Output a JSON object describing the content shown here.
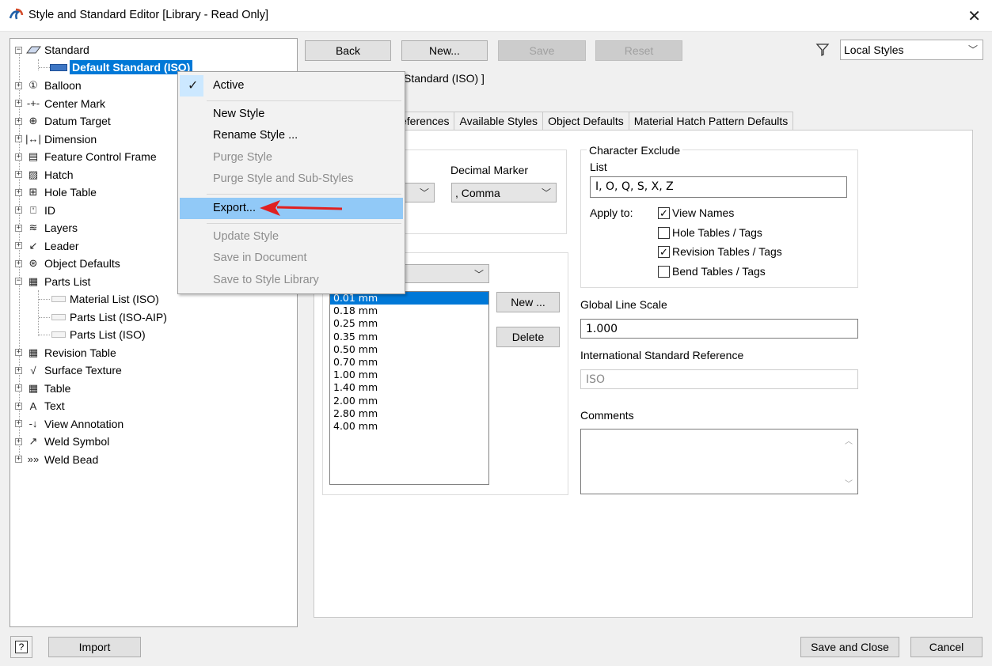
{
  "window": {
    "title": "Style and Standard Editor [Library - Read Only]"
  },
  "tree": {
    "root": "Standard",
    "selected": "Default Standard (ISO)",
    "items": [
      {
        "label": "Balloon",
        "icon": "balloon-icon",
        "glyph": "①"
      },
      {
        "label": "Center Mark",
        "icon": "center-mark-icon",
        "glyph": "-+-"
      },
      {
        "label": "Datum Target",
        "icon": "datum-target-icon",
        "glyph": "⊕"
      },
      {
        "label": "Dimension",
        "icon": "dimension-icon",
        "glyph": "|↔|"
      },
      {
        "label": "Feature Control Frame",
        "icon": "feature-control-frame-icon",
        "glyph": "▤"
      },
      {
        "label": "Hatch",
        "icon": "hatch-icon",
        "glyph": "▨"
      },
      {
        "label": "Hole Table",
        "icon": "hole-table-icon",
        "glyph": "⊞"
      },
      {
        "label": "ID",
        "icon": "id-icon",
        "glyph": "⍞"
      },
      {
        "label": "Layers",
        "icon": "layers-icon",
        "glyph": "≋"
      },
      {
        "label": "Leader",
        "icon": "leader-icon",
        "glyph": "↙"
      },
      {
        "label": "Object Defaults",
        "icon": "object-defaults-icon",
        "glyph": "⊛"
      },
      {
        "label": "Parts List",
        "icon": "parts-list-icon",
        "glyph": "▦"
      }
    ],
    "parts_children": [
      "Material List (ISO)",
      "Parts List (ISO-AIP)",
      "Parts List (ISO)"
    ],
    "items_after": [
      {
        "label": "Revision Table",
        "icon": "revision-table-icon",
        "glyph": "▦"
      },
      {
        "label": "Surface Texture",
        "icon": "surface-texture-icon",
        "glyph": "√"
      },
      {
        "label": "Table",
        "icon": "table-icon",
        "glyph": "▦"
      },
      {
        "label": "Text",
        "icon": "text-icon",
        "glyph": "A"
      },
      {
        "label": "View Annotation",
        "icon": "view-annotation-icon",
        "glyph": "-↓"
      },
      {
        "label": "Weld Symbol",
        "icon": "weld-symbol-icon",
        "glyph": "↗"
      },
      {
        "label": "Weld Bead",
        "icon": "weld-bead-icon",
        "glyph": "»»"
      }
    ]
  },
  "toolbar": {
    "back": "Back",
    "new": "New...",
    "save": "Save",
    "reset": "Reset",
    "filter": "Local Styles"
  },
  "header_partial": "Standard (ISO) ]",
  "tabs": [
    "eferences",
    "Available Styles",
    "Object Defaults",
    "Material Hatch Pattern Defaults"
  ],
  "units": {
    "decimal_marker_label": "Decimal Marker",
    "decimal_marker_value": ", Comma"
  },
  "line_weights": {
    "values": [
      "0.01 mm",
      "0.18 mm",
      "0.25 mm",
      "0.35 mm",
      "0.50 mm",
      "0.70 mm",
      "1.00 mm",
      "1.40 mm",
      "2.00 mm",
      "2.80 mm",
      "4.00 mm"
    ],
    "new": "New ...",
    "delete": "Delete"
  },
  "char_exclude": {
    "legend": "Character Exclude",
    "list_label": "List",
    "list_value": "I, O, Q, S, X, Z",
    "apply_label": "Apply to:",
    "options": [
      {
        "label": "View Names",
        "checked": "✓"
      },
      {
        "label": "Hole Tables / Tags",
        "checked": ""
      },
      {
        "label": "Revision Tables / Tags",
        "checked": "✓"
      },
      {
        "label": "Bend Tables / Tags",
        "checked": ""
      }
    ]
  },
  "global_line_scale": {
    "label": "Global Line Scale",
    "value": "1.000"
  },
  "intl_std_ref": {
    "label": "International Standard Reference",
    "value": "ISO"
  },
  "comments": {
    "label": "Comments"
  },
  "context_menu": {
    "active": "Active",
    "new_style": "New Style",
    "rename_style": "Rename Style ...",
    "purge_style": "Purge Style",
    "purge_sub": "Purge Style and Sub-Styles",
    "export": "Export...",
    "update_style": "Update Style",
    "save_in_document": "Save in Document",
    "save_to_library": "Save to Style Library"
  },
  "footer": {
    "help": "?",
    "import": "Import",
    "save_close": "Save and Close",
    "cancel": "Cancel"
  },
  "colors": {
    "selection": "#0078d7",
    "menu_highlight": "#91c9f7",
    "arrow": "#e02020"
  }
}
